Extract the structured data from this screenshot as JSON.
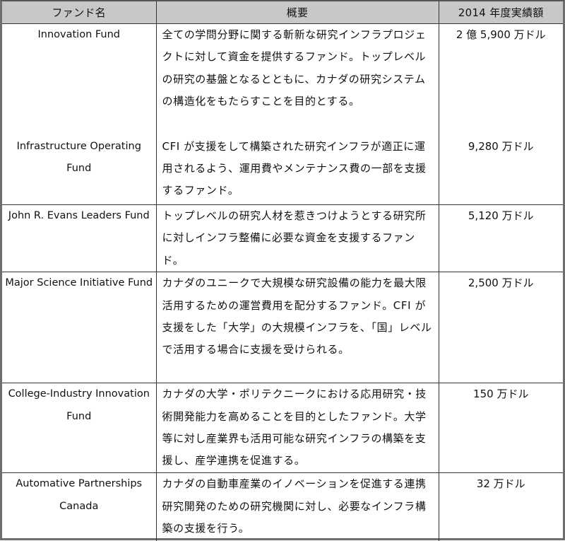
{
  "table": {
    "headers": [
      "ファンド名",
      "概要",
      "2014 年度実績額"
    ],
    "rows": [
      {
        "name": "Innovation Fund",
        "description": "全ての学問分野に関する斬新な研究インフラプロジェクトに対して資金を提供するファンド。トップレベルの研究の基盤となるとともに、カナダの研究システムの構造化をもたらすことを目的とする。",
        "amount": "2 億 5,900 万ドル"
      },
      {
        "name": "Infrastructure Operating Fund",
        "description": "CFI が支援をして構築された研究インフラが適正に運用されるよう、運用費やメンテナンス費の一部を支援するファンド。",
        "amount": "9,280 万ドル"
      },
      {
        "name": "John R. Evans Leaders Fund",
        "description": "トップレベルの研究人材を惹きつけようとする研究所に対しインフラ整備に必要な資金を支援するファンド。",
        "amount": "5,120 万ドル"
      },
      {
        "name": "Major Science Initiative Fund",
        "description": "カナダのユニークで大規模な研究設備の能力を最大限活用するための運営費用を配分するファンド。CFI が支援をした「大学」の大規模インフラを、「国」レベルで活用する場合に支援を受けられる。",
        "amount": "2,500 万ドル"
      },
      {
        "name": "College-Industry Innovation Fund",
        "description": "カナダの大学・ポリテクニークにおける応用研究・技術開発能力を高めることを目的としたファンド。大学等に対し産業界も活用可能な研究インフラの構築を支援し、産学連携を促進する。",
        "amount": "150 万ドル"
      },
      {
        "name": "Automative Partnerships Canada",
        "description": "カナダの自動車産業のイノベーションを促進する連携研究開発のための研究機関に対し、必要なインフラ構築の支援を行う。",
        "amount": "32 万ドル"
      }
    ]
  }
}
